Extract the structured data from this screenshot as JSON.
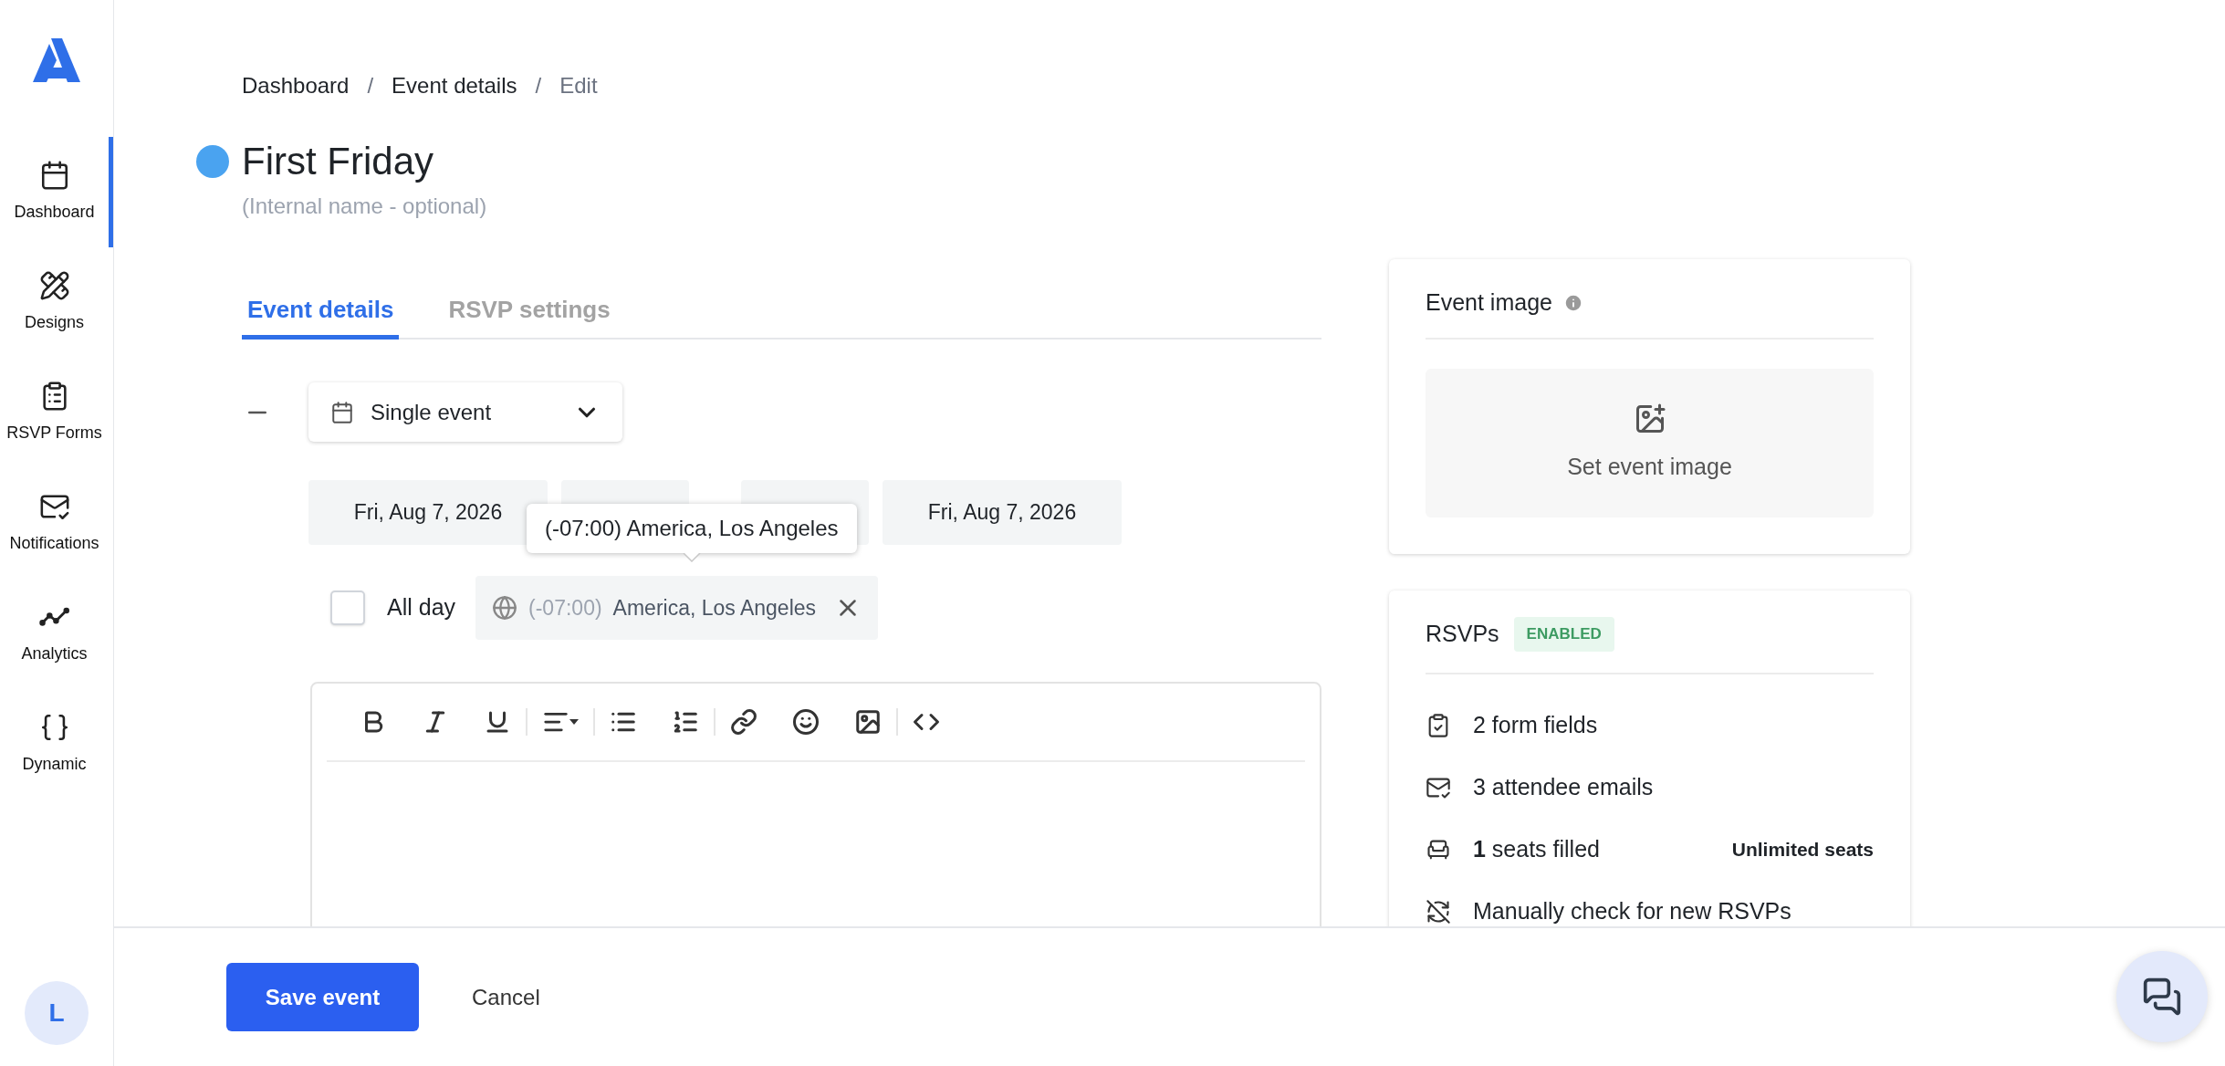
{
  "sidebar": {
    "items": [
      {
        "kind": "dashboard",
        "label": "Dashboard",
        "selected": true
      },
      {
        "kind": "designs",
        "label": "Designs",
        "selected": false
      },
      {
        "kind": "forms",
        "label": "RSVP Forms",
        "selected": false
      },
      {
        "kind": "notifications",
        "label": "Notifications",
        "selected": false
      },
      {
        "kind": "analytics",
        "label": "Analytics",
        "selected": false
      },
      {
        "kind": "dynamic",
        "label": "Dynamic",
        "selected": false
      }
    ],
    "avatar": "L"
  },
  "breadcrumb": {
    "items": [
      {
        "label": "Dashboard",
        "current": false
      },
      {
        "label": "Event details",
        "current": false
      },
      {
        "label": "Edit",
        "current": true
      }
    ],
    "separators": [
      "/",
      "/"
    ]
  },
  "event": {
    "title": "First Friday",
    "internal_name": {
      "placeholder": "(Internal name - optional)"
    }
  },
  "tabs": [
    {
      "label": "Event details",
      "selected": true
    },
    {
      "label": "RSVP settings",
      "selected": false
    }
  ],
  "event_type": {
    "value": "Single event"
  },
  "date_fields": [
    {
      "kind": "date",
      "value": "Fri, Aug 7, 2026"
    },
    {
      "kind": "time"
    },
    {
      "kind": "time"
    },
    {
      "kind": "date",
      "value": "Fri, Aug 7, 2026"
    }
  ],
  "tooltip": "(-07:00) America, Los Angeles",
  "all_day": {
    "label": "All day",
    "checked": false
  },
  "timezone": {
    "offset": "(-07:00)",
    "name": "America, Los Angeles"
  },
  "event_image": {
    "title": "Event image",
    "button": "Set event image"
  },
  "rsvps": {
    "title": "RSVPs",
    "badge": "ENABLED",
    "stats": [
      {
        "kind": "form",
        "text": "2 form fields"
      },
      {
        "kind": "email",
        "text": "3 attendee emails"
      },
      {
        "kind": "seats",
        "text": "**1** seats filled",
        "aside": "Unlimited seats"
      },
      {
        "kind": "manual",
        "text": "Manually check for new RSVPs"
      }
    ]
  },
  "footer": {
    "save": "Save event",
    "cancel": "Cancel"
  }
}
